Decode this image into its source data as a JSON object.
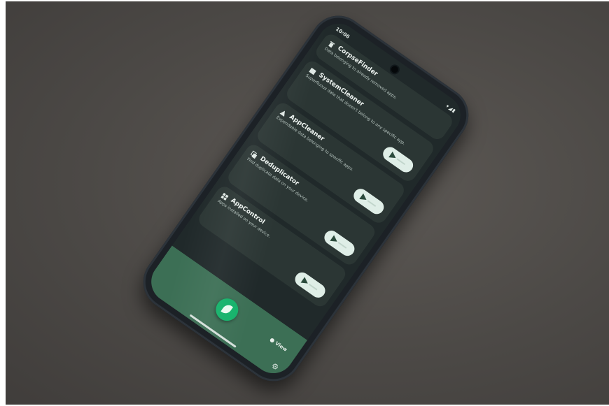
{
  "status_bar": {
    "time": "10:06",
    "right_icons": "▾◢▮"
  },
  "tools": [
    {
      "title": "CorpseFinder",
      "description": "Data belonging to already removed apps.",
      "icon": "trash-icon",
      "has_scan_button": false
    },
    {
      "title": "SystemCleaner",
      "description": "Superfluous data that doesn't belong to any specific app.",
      "icon": "folder-icon",
      "has_scan_button": true
    },
    {
      "title": "AppCleaner",
      "description": "Expendable data belonging to specific apps.",
      "icon": "recycle-icon",
      "has_scan_button": true
    },
    {
      "title": "Deduplicator",
      "description": "Find duplicate data on your device.",
      "icon": "copy-icon",
      "has_scan_button": true
    },
    {
      "title": "AppControl",
      "description": "Apps installed on your device.",
      "icon": "grid-icon",
      "has_scan_button": true
    }
  ],
  "bottom_bar": {
    "view_label": "View",
    "fab_icon": "leaf-icon",
    "settings_icon": "gear-icon"
  },
  "colors": {
    "surface": "#20292a",
    "card": "#2b3634",
    "bottom_bar": "#3c6f55",
    "accent": "#14b26a",
    "background_table": "#4c4946"
  }
}
